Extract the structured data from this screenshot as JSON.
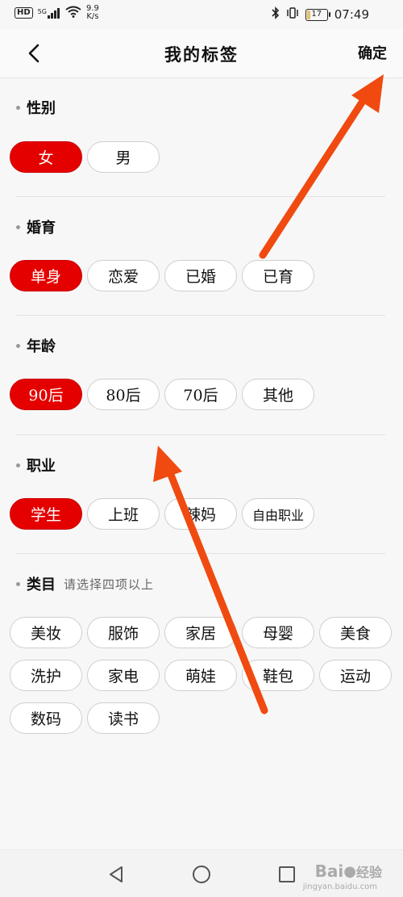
{
  "status_bar": {
    "hd": "HD",
    "signal_label": "5G",
    "net_speed_value": "9.9",
    "net_speed_unit": "K/s",
    "battery": "17",
    "battery_level": 0.17,
    "time": "07:49"
  },
  "header": {
    "title": "我的标签",
    "confirm_label": "确定"
  },
  "sections": {
    "gender": {
      "title": "性别",
      "options": [
        "女",
        "男"
      ],
      "selected": "女"
    },
    "marriage": {
      "title": "婚育",
      "options": [
        "单身",
        "恋爱",
        "已婚",
        "已育"
      ],
      "selected": "单身"
    },
    "age": {
      "title": "年龄",
      "options": [
        "90后",
        "80后",
        "70后",
        "其他"
      ],
      "selected": "90后"
    },
    "job": {
      "title": "职业",
      "options": [
        "学生",
        "上班",
        "辣妈",
        "自由职业"
      ],
      "selected": "学生"
    },
    "category": {
      "title": "类目",
      "hint": "请选择四项以上",
      "options": [
        "美妆",
        "服饰",
        "家居",
        "母婴",
        "美食",
        "洗护",
        "家电",
        "萌娃",
        "鞋包",
        "运动",
        "数码",
        "读书"
      ]
    }
  },
  "watermark": {
    "brand": "Bai",
    "brand_suffix": "经验",
    "sub": "jingyan.baidu.com"
  },
  "colors": {
    "accent": "#e50000",
    "arrow": "#f04a10"
  }
}
